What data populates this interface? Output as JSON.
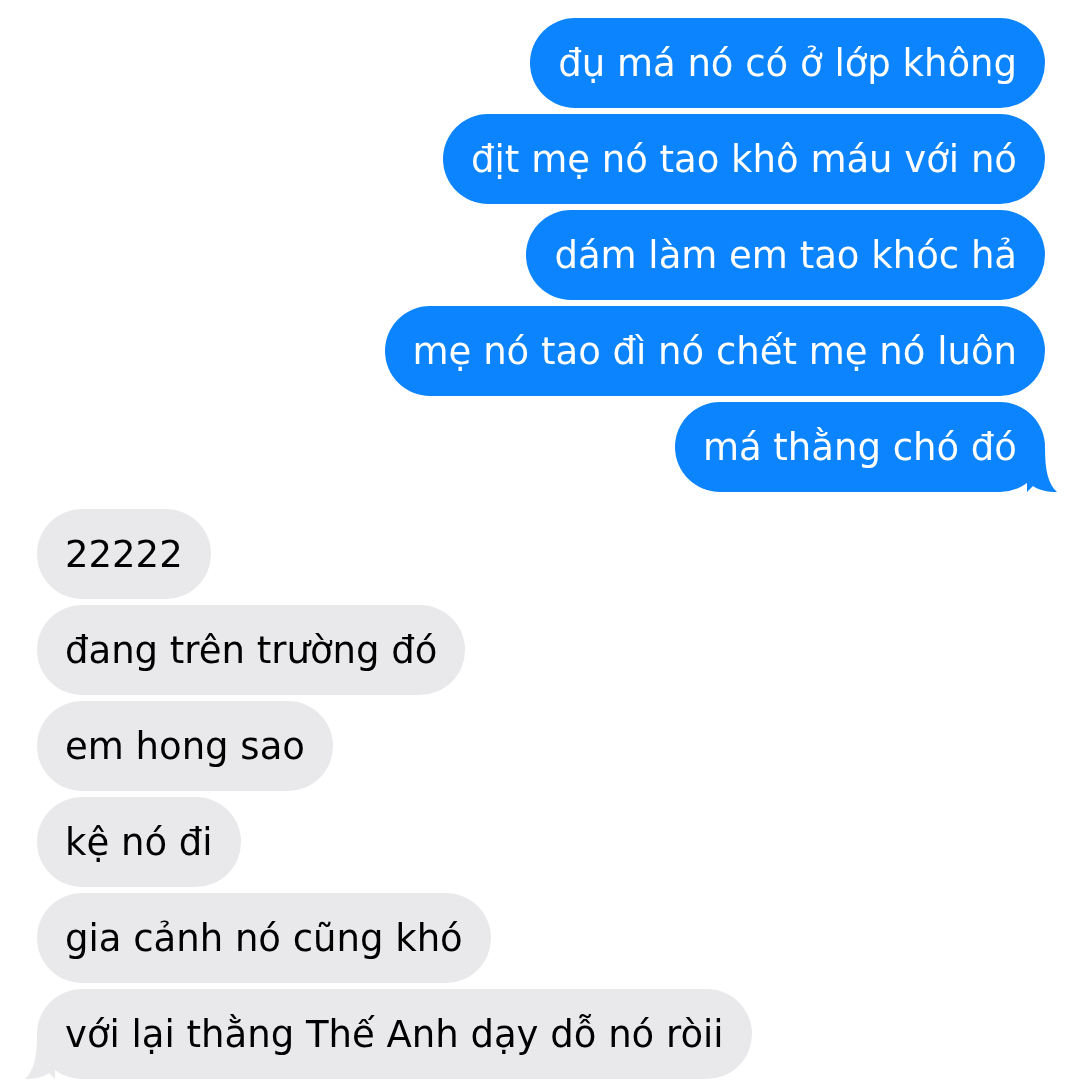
{
  "messages": [
    {
      "kind": "sent",
      "text": "đụ má nó có ở lớp không",
      "tail": false
    },
    {
      "kind": "sent",
      "text": "địt mẹ nó tao khô máu với nó",
      "tail": false
    },
    {
      "kind": "sent",
      "text": "dám làm em tao khóc hả",
      "tail": false
    },
    {
      "kind": "sent",
      "text": "mẹ nó tao đì nó chết mẹ nó luôn",
      "tail": false
    },
    {
      "kind": "sent",
      "text": "má thằng chó đó",
      "tail": true
    },
    {
      "kind": "received",
      "text": "22222",
      "tail": false
    },
    {
      "kind": "received",
      "text": "đang trên trường đó",
      "tail": false
    },
    {
      "kind": "received",
      "text": "em hong sao",
      "tail": false
    },
    {
      "kind": "received",
      "text": "kệ nó đi",
      "tail": false
    },
    {
      "kind": "received",
      "text": "gia cảnh nó cũng khó",
      "tail": false
    },
    {
      "kind": "received",
      "text": "với lại thằng Thế Anh dạy dỗ nó ròii",
      "tail": true
    }
  ]
}
